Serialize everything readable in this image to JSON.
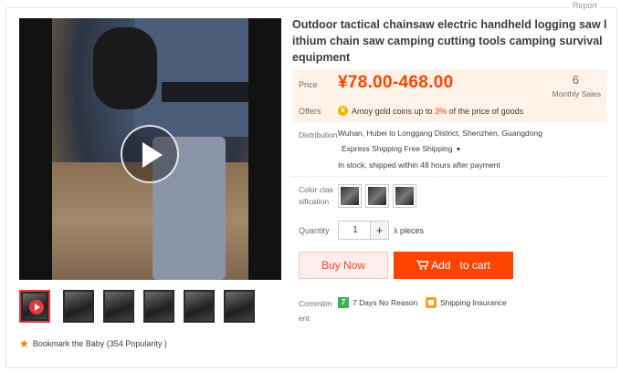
{
  "report": "Report",
  "title": "Outdoor tactical chainsaw electric handheld logging saw lithium chain saw camping cutting tools camping survival equipment",
  "price": {
    "label": "Price",
    "value": "¥78.00-468.00",
    "sales_count": "6",
    "sales_label": "Monthly Sales",
    "offers_label": "Offers",
    "offers_prefix": "Amoy gold coins up to ",
    "offers_pct": "3%",
    "offers_suffix": " of the price of goods"
  },
  "distribution": {
    "label": "Distribution",
    "route": "Wuhan, Hubei to  Longgang District, Shenzhen, Guangdong",
    "shipping": "Express Shipping Free Shipping",
    "stock": "In stock, shipped within 48 hours after payment"
  },
  "color": {
    "label": "Color classification",
    "option_count": 3
  },
  "quantity": {
    "label": "Quantity",
    "value": "1",
    "plus": "+",
    "unit": "λ pieces"
  },
  "actions": {
    "buy_now": "Buy Now",
    "add_to_cart": "Add   to cart"
  },
  "commitment": {
    "label": "Commitment",
    "item1": "7 Days No Reason",
    "item2": "Shipping Insurance"
  },
  "bookmark": "Bookmark the Baby (354 Popularity )",
  "colors": {
    "accent": "#ff4400",
    "price_bg": "#fff2e8",
    "buy_now_bg": "#ffeded",
    "commit_green": "#3bb35d",
    "star": "#ff7300"
  },
  "icons": [
    "play-icon",
    "star-icon",
    "coin-icon",
    "cart-icon",
    "seven-days-icon",
    "shield-icon",
    "caret-down-icon",
    "plus-icon"
  ]
}
